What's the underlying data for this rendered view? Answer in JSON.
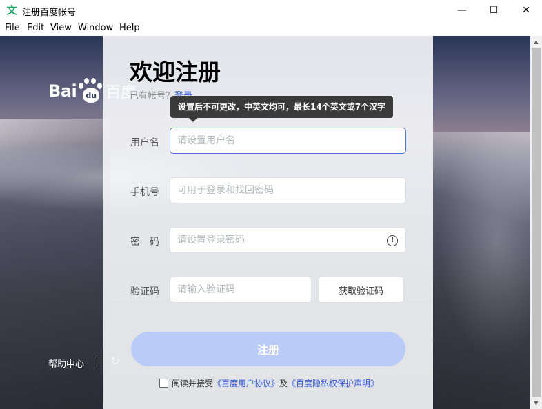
{
  "window": {
    "title": "注册百度帐号",
    "app_icon": "文",
    "minimize_glyph": "—",
    "maximize_glyph": "☐",
    "close_glyph": "✕"
  },
  "menu": [
    "File",
    "Edit",
    "Window",
    "Help"
  ],
  "menu_full": [
    "File",
    "Edit",
    "View",
    "Window",
    "Help"
  ],
  "logo": {
    "latin_left": "Bai",
    "latin_du": "du",
    "chinese": "百度"
  },
  "sidebar": {
    "help": "帮助中心"
  },
  "form": {
    "title": "欢迎注册",
    "have_account": "已有帐号？",
    "login_link": "登录",
    "tooltip": "设置后不可更改，中英文均可，最长14个英文或7个汉字",
    "username": {
      "label": "用户名",
      "placeholder": "请设置用户名"
    },
    "phone": {
      "label": "手机号",
      "placeholder": "可用于登录和找回密码"
    },
    "password": {
      "label": "密　码",
      "placeholder": "请设置登录密码"
    },
    "code": {
      "label": "验证码",
      "placeholder": "请输入验证码",
      "button": "获取验证码"
    },
    "submit": "注册",
    "agree_prefix": "阅读并接受",
    "agree_terms": "《百度用户协议》",
    "agree_and": "及",
    "agree_privacy": "《百度隐私权保护声明》"
  },
  "colors": {
    "accent": "#2e58d6",
    "submit_bg": "#b9cbf6",
    "focus_border": "#4a6fd6"
  }
}
